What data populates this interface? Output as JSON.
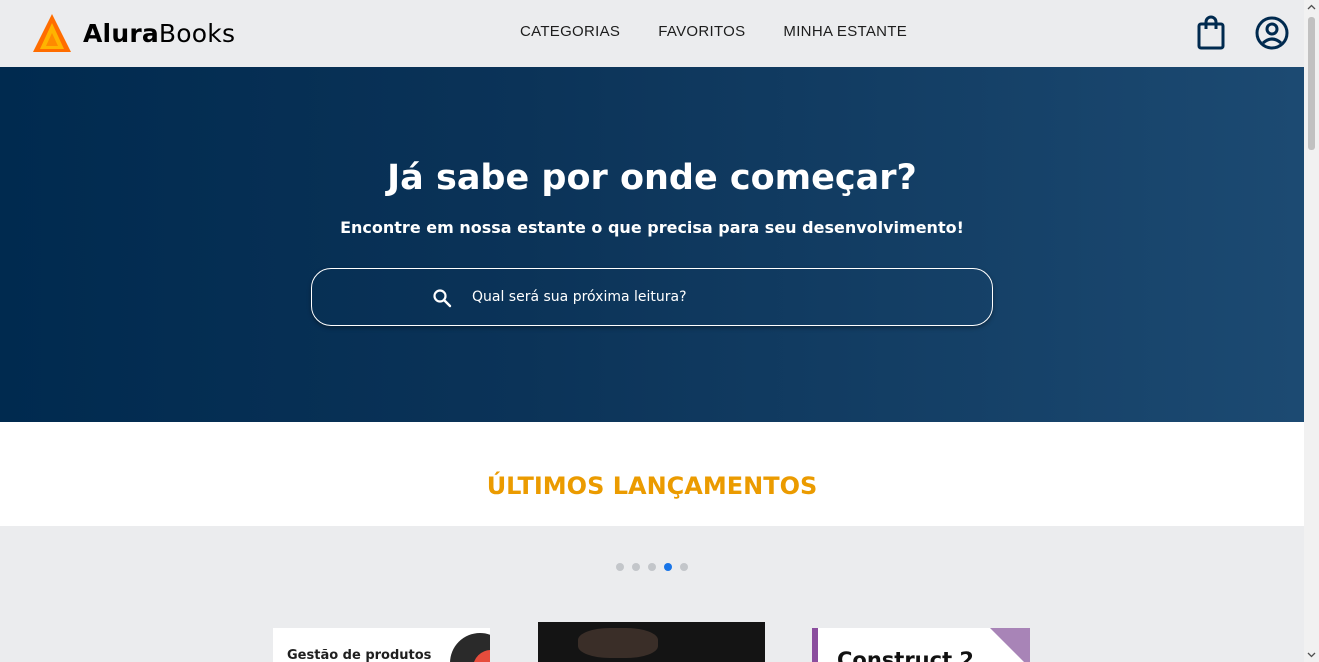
{
  "header": {
    "logo_bold": "Alura",
    "logo_light": "Books",
    "nav": [
      "CATEGORIAS",
      "FAVORITOS",
      "MINHA ESTANTE"
    ],
    "icons": [
      "shopping-bag-icon",
      "user-icon"
    ]
  },
  "hero": {
    "title": "Já sabe por onde começar?",
    "subtitle": "Encontre em nossa estante o que precisa para seu desenvolvimento!",
    "search_placeholder": "Qual será sua próxima leitura?"
  },
  "releases": {
    "title": "ÚLTIMOS LANÇAMENTOS",
    "dots_count": 5,
    "active_dot": 4,
    "books": [
      {
        "cover_text": "Gestão de produtos"
      },
      {
        "cover_text": ""
      },
      {
        "cover_text": "Construct 2"
      }
    ]
  },
  "colors": {
    "accent_orange": "#eb9b00",
    "hero_dark": "#002a4f",
    "active_dot": "#1875e8"
  }
}
